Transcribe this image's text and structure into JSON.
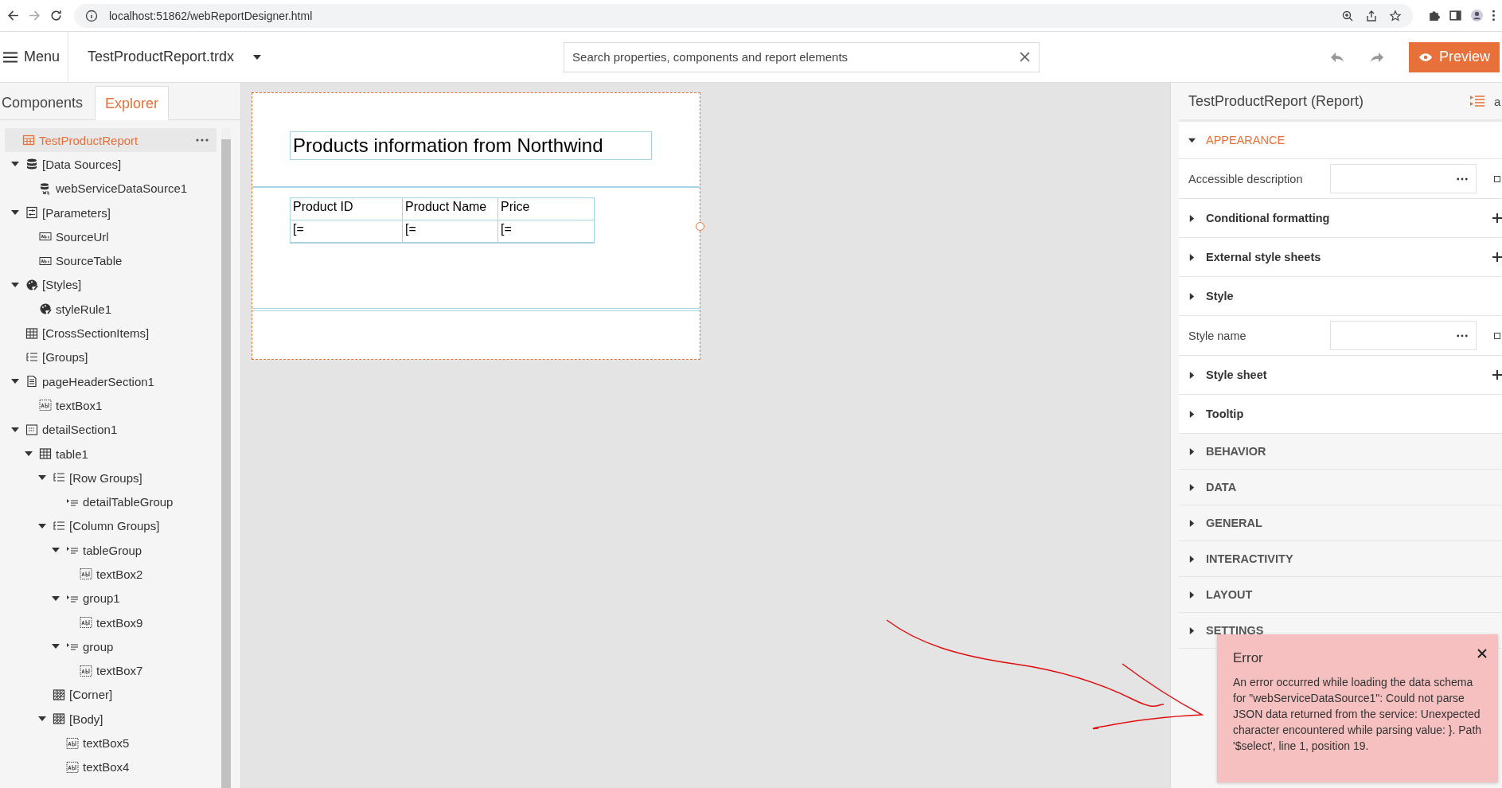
{
  "browser": {
    "url": "localhost:51862/webReportDesigner.html"
  },
  "toolbar": {
    "menu": "Menu",
    "file": "TestProductReport.trdx",
    "search": {
      "placeholder": "Search properties, components and report elements"
    },
    "preview": "Preview"
  },
  "explorer": {
    "tabs": [
      {
        "label": "Components",
        "selected": false
      },
      {
        "label": "Explorer",
        "selected": true
      }
    ],
    "tree": [
      {
        "label": "TestProductReport",
        "kind": "report",
        "selected": true,
        "children": [
          {
            "label": "[Data Sources]",
            "kind": "database",
            "selected": false,
            "expanded": true,
            "children": [
              {
                "label": "webServiceDataSource1",
                "kind": "web-database",
                "selected": false
              }
            ]
          },
          {
            "label": "[Parameters]",
            "kind": "parameters",
            "selected": false,
            "expanded": true,
            "children": [
              {
                "label": "SourceUrl",
                "kind": "text-param",
                "selected": false
              },
              {
                "label": "SourceTable",
                "kind": "text-param",
                "selected": false
              }
            ]
          },
          {
            "label": "[Styles]",
            "kind": "palette",
            "selected": false,
            "expanded": true,
            "children": [
              {
                "label": "styleRule1",
                "kind": "palette",
                "selected": false
              }
            ]
          },
          {
            "label": "[CrossSectionItems]",
            "kind": "table",
            "selected": false
          },
          {
            "label": "[Groups]",
            "kind": "groups",
            "selected": false
          },
          {
            "label": "pageHeaderSection1",
            "kind": "page",
            "selected": false,
            "expanded": true,
            "children": [
              {
                "label": "textBox1",
                "kind": "textbox",
                "selected": false
              }
            ]
          },
          {
            "label": "detailSection1",
            "kind": "section",
            "selected": false,
            "expanded": true,
            "children": [
              {
                "label": "table1",
                "kind": "table",
                "selected": false,
                "expanded": true,
                "children": [
                  {
                    "label": "[Row Groups]",
                    "kind": "groups",
                    "selected": false,
                    "expanded": true,
                    "children": [
                      {
                        "label": "detailTableGroup",
                        "kind": "group",
                        "selected": false
                      }
                    ]
                  },
                  {
                    "label": "[Column Groups]",
                    "kind": "groups",
                    "selected": false,
                    "expanded": true,
                    "children": [
                      {
                        "label": "tableGroup",
                        "kind": "group",
                        "selected": false,
                        "expanded": true,
                        "children": [
                          {
                            "label": "textBox2",
                            "kind": "textbox",
                            "selected": false
                          }
                        ]
                      },
                      {
                        "label": "group1",
                        "kind": "group",
                        "selected": false,
                        "expanded": true,
                        "children": [
                          {
                            "label": "textBox9",
                            "kind": "textbox",
                            "selected": false
                          }
                        ]
                      },
                      {
                        "label": "group",
                        "kind": "group",
                        "selected": false,
                        "expanded": true,
                        "children": [
                          {
                            "label": "textBox7",
                            "kind": "textbox",
                            "selected": false
                          }
                        ]
                      }
                    ]
                  },
                  {
                    "label": "[Corner]",
                    "kind": "corner",
                    "selected": false
                  },
                  {
                    "label": "[Body]",
                    "kind": "corner",
                    "selected": false,
                    "expanded": true,
                    "children": [
                      {
                        "label": "textBox5",
                        "kind": "textbox",
                        "selected": false
                      },
                      {
                        "label": "textBox4",
                        "kind": "textbox",
                        "selected": false
                      }
                    ]
                  }
                ]
              }
            ]
          }
        ]
      }
    ]
  },
  "report": {
    "title": "Products information from Northwind",
    "columns": [
      "Product ID",
      "Product Name",
      "Price"
    ],
    "cells": [
      "[=",
      "[=",
      "[="
    ]
  },
  "properties": {
    "title": "TestProductReport (Report)",
    "view_toggle": "a",
    "items": [
      {
        "kind": "category",
        "label": "APPEARANCE",
        "expanded": true
      },
      {
        "kind": "editor",
        "label": "Accessible description",
        "checked": false
      },
      {
        "kind": "group",
        "label": "Conditional formatting",
        "expanded": false,
        "addable": true
      },
      {
        "kind": "group",
        "label": "External style sheets",
        "expanded": false,
        "addable": true
      },
      {
        "kind": "group",
        "label": "Style",
        "expanded": false,
        "addable": false
      },
      {
        "kind": "editor",
        "label": "Style name",
        "checked": false
      },
      {
        "kind": "group",
        "label": "Style sheet",
        "expanded": false,
        "addable": true
      },
      {
        "kind": "group",
        "label": "Tooltip",
        "expanded": false,
        "addable": false
      },
      {
        "kind": "category",
        "label": "BEHAVIOR",
        "expanded": false
      },
      {
        "kind": "category",
        "label": "DATA",
        "expanded": false
      },
      {
        "kind": "category",
        "label": "GENERAL",
        "expanded": false
      },
      {
        "kind": "category",
        "label": "INTERACTIVITY",
        "expanded": false
      },
      {
        "kind": "category",
        "label": "LAYOUT",
        "expanded": false
      },
      {
        "kind": "category",
        "label": "SETTINGS",
        "expanded": false
      }
    ]
  },
  "error": {
    "title": "Error",
    "message": "An error occurred while loading the data schema for \"webServiceDataSource1\": Could not parse JSON data returned from the service: Unexpected character encountered while parsing value: }. Path '$select', line 1, position 19."
  }
}
